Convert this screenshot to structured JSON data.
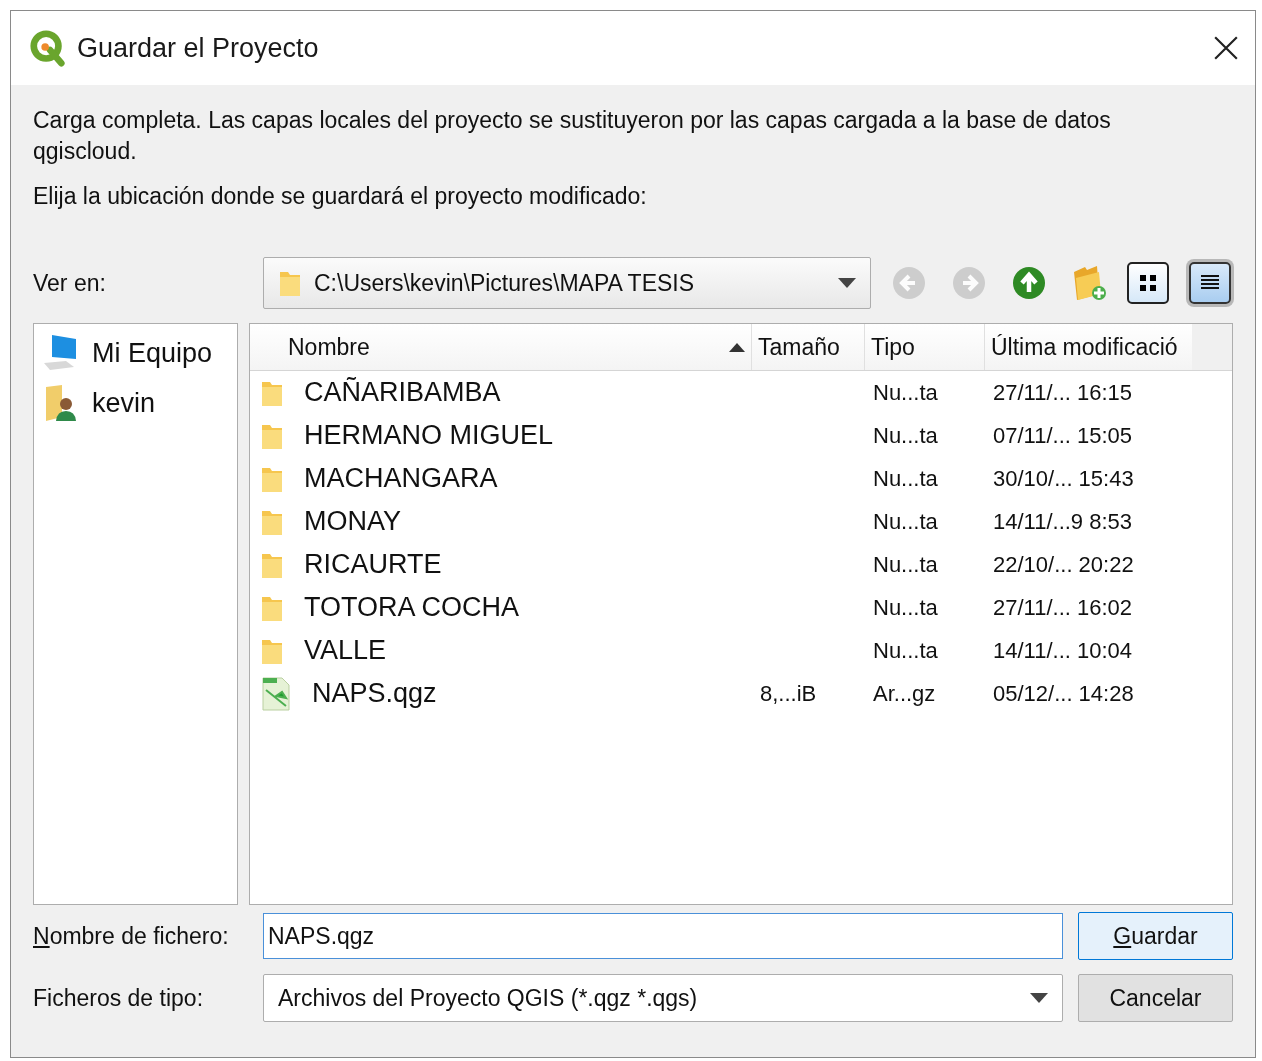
{
  "window": {
    "title": "Guardar el Proyecto"
  },
  "message": [
    "Carga completa. Las capas locales del proyecto se sustituyeron por las capas cargada a la base de datos qgiscloud.",
    "Elija la ubicación donde se guardará el proyecto modificado:"
  ],
  "look_in": {
    "label": "Ver en:",
    "value": "C:\\Users\\kevin\\Pictures\\MAPA TESIS"
  },
  "toolbar": [
    {
      "kind": "back",
      "disabled": true
    },
    {
      "kind": "forward",
      "disabled": true
    },
    {
      "kind": "up",
      "disabled": false
    },
    {
      "kind": "new_folder"
    },
    {
      "kind": "list_view",
      "selected": false
    },
    {
      "kind": "detail_view",
      "selected": true
    }
  ],
  "sidebar": {
    "items": [
      {
        "kind": "computer",
        "label": "Mi Equipo"
      },
      {
        "kind": "user",
        "label": "kevin"
      }
    ]
  },
  "table": {
    "columns": [
      "Nombre",
      "Tamaño",
      "Tipo",
      "Última modificació"
    ],
    "rows": [
      {
        "kind": "folder",
        "name": "CAÑARIBAMBA",
        "type": "Nu...ta",
        "modified": "27/11/... 16:15"
      },
      {
        "kind": "folder",
        "name": "HERMANO MIGUEL",
        "type": "Nu...ta",
        "modified": "07/11/... 15:05"
      },
      {
        "kind": "folder",
        "name": "MACHANGARA",
        "type": "Nu...ta",
        "modified": "30/10/... 15:43"
      },
      {
        "kind": "folder",
        "name": "MONAY",
        "type": "Nu...ta",
        "modified": "14/11/...9 8:53"
      },
      {
        "kind": "folder",
        "name": "RICAURTE",
        "type": "Nu...ta",
        "modified": "22/10/... 20:22"
      },
      {
        "kind": "folder",
        "name": "TOTORA COCHA",
        "type": "Nu...ta",
        "modified": "27/11/... 16:02"
      },
      {
        "kind": "folder",
        "name": "VALLE",
        "type": "Nu...ta",
        "modified": "14/11/... 10:04"
      },
      {
        "kind": "file",
        "name": "NAPS.qgz",
        "size": "8,...iB",
        "type": "Ar...gz",
        "modified": "05/12/... 14:28"
      }
    ]
  },
  "filename": {
    "label": "Nombre de fichero:",
    "value": "NAPS.qgz"
  },
  "filetype": {
    "label": "Ficheros de tipo:",
    "value": "Archivos del Proyecto QGIS (*.qgz *.qgs)"
  },
  "buttons": [
    {
      "label": "Guardar",
      "default": true
    },
    {
      "label": "Cancelar",
      "default": false
    }
  ]
}
